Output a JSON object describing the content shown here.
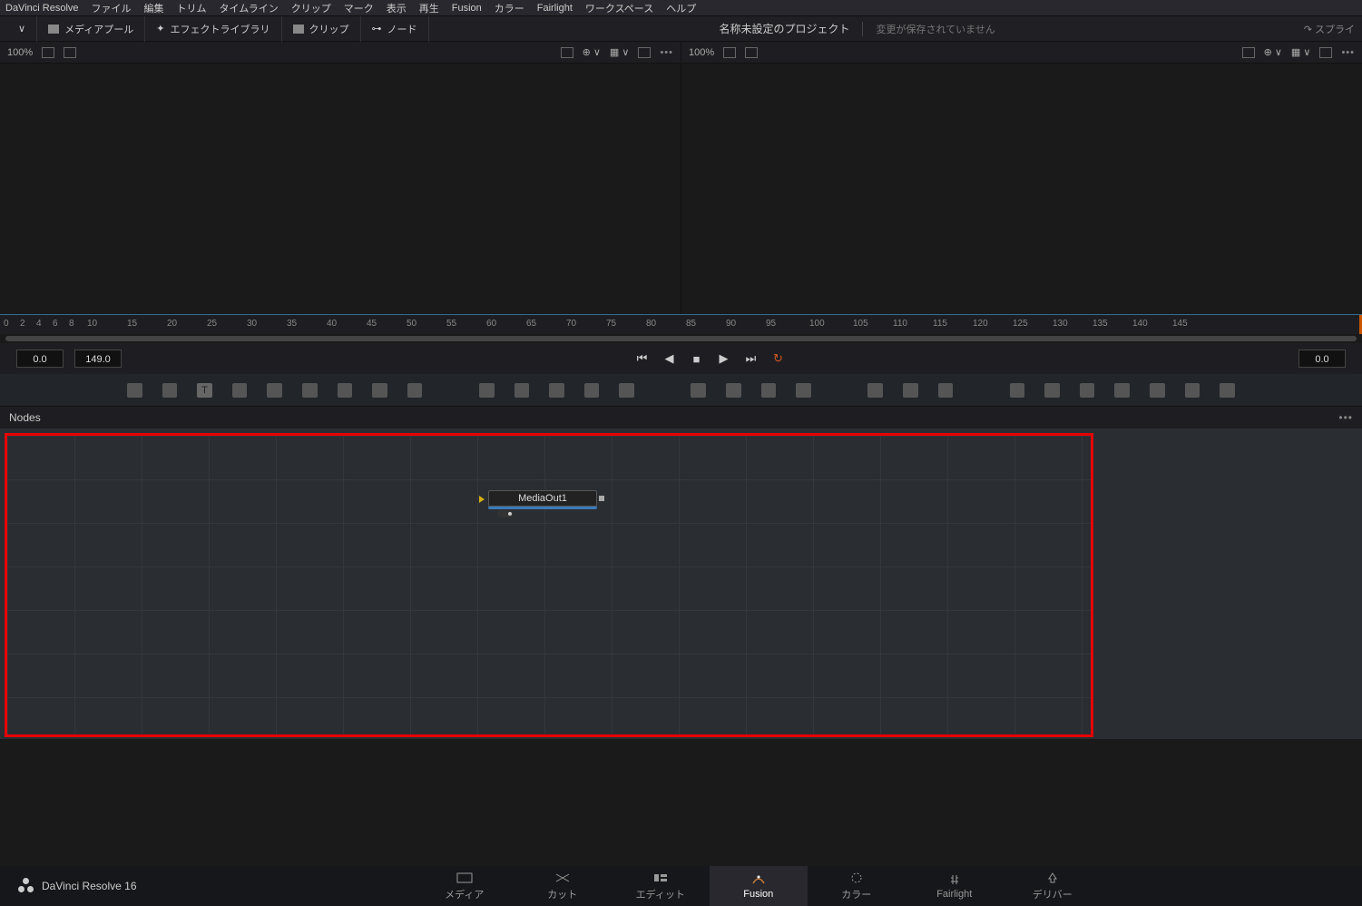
{
  "app_name": "DaVinci Resolve",
  "menu": [
    "ファイル",
    "編集",
    "トリム",
    "タイムライン",
    "クリップ",
    "マーク",
    "表示",
    "再生",
    "Fusion",
    "カラー",
    "Fairlight",
    "ワークスペース",
    "ヘルプ"
  ],
  "toolbar": {
    "media_pool": "メディアプール",
    "effects_lib": "エフェクトライブラリ",
    "clips": "クリップ",
    "nodes": "ノード",
    "spline": "スプライ"
  },
  "project_title": "名称未設定のプロジェクト",
  "unsaved_text": "変更が保存されていません",
  "viewer_left": {
    "zoom": "100%"
  },
  "viewer_right": {
    "zoom": "100%"
  },
  "ruler_ticks": [
    "0",
    "2",
    "4",
    "6",
    "8",
    "10",
    "15",
    "20",
    "25",
    "30",
    "35",
    "40",
    "45",
    "50",
    "55",
    "60",
    "65",
    "70",
    "75",
    "80",
    "85",
    "90",
    "95",
    "100",
    "105",
    "110",
    "115",
    "120",
    "125",
    "130",
    "135",
    "140",
    "145"
  ],
  "transport": {
    "start": "0.0",
    "end": "149.0",
    "current": "0.0"
  },
  "nodes_panel_title": "Nodes",
  "node1_label": "MediaOut1",
  "brand_label": "DaVinci Resolve 16",
  "pages": [
    {
      "id": "media",
      "label": "メディア"
    },
    {
      "id": "cut",
      "label": "カット"
    },
    {
      "id": "edit",
      "label": "エディット"
    },
    {
      "id": "fusion",
      "label": "Fusion"
    },
    {
      "id": "color",
      "label": "カラー"
    },
    {
      "id": "fairlight",
      "label": "Fairlight"
    },
    {
      "id": "deliver",
      "label": "デリバー"
    }
  ],
  "active_page": "fusion"
}
